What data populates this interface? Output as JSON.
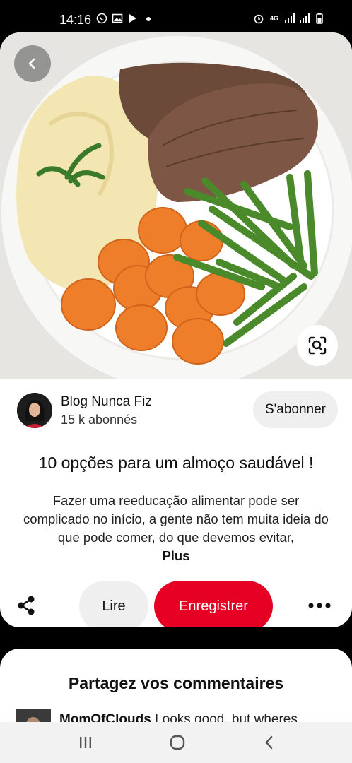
{
  "status_bar": {
    "time": "14:16",
    "left_icons": [
      "whatsapp-icon",
      "gallery-icon",
      "play-store-icon",
      "dot-icon"
    ],
    "right_icons": [
      "alarm-icon",
      "4g-icon",
      "signal-icon",
      "signal-icon-2",
      "battery-icon"
    ],
    "network_label": "4G"
  },
  "pin": {
    "image_alt": "Plate with steak, mashed potatoes, sliced carrots and green beans",
    "title": "10 opções para um almoço saudável !",
    "description": "Fazer uma reeducação alimentar pode ser complicado no início, a gente não tem muita ideia do que pode comer, do que devemos evitar,",
    "more_label": "Plus"
  },
  "creator": {
    "name": "Blog Nunca Fiz",
    "followers": "15 k abonnés",
    "subscribe_label": "S'abonner"
  },
  "actions": {
    "read_label": "Lire",
    "save_label": "Enregistrer"
  },
  "comments": {
    "title": "Partagez vos commentaires",
    "first": {
      "user": "MomOfClouds",
      "text": " Looks good, but wheres"
    }
  },
  "colors": {
    "accent": "#e60023",
    "button_gray": "#efefef"
  }
}
